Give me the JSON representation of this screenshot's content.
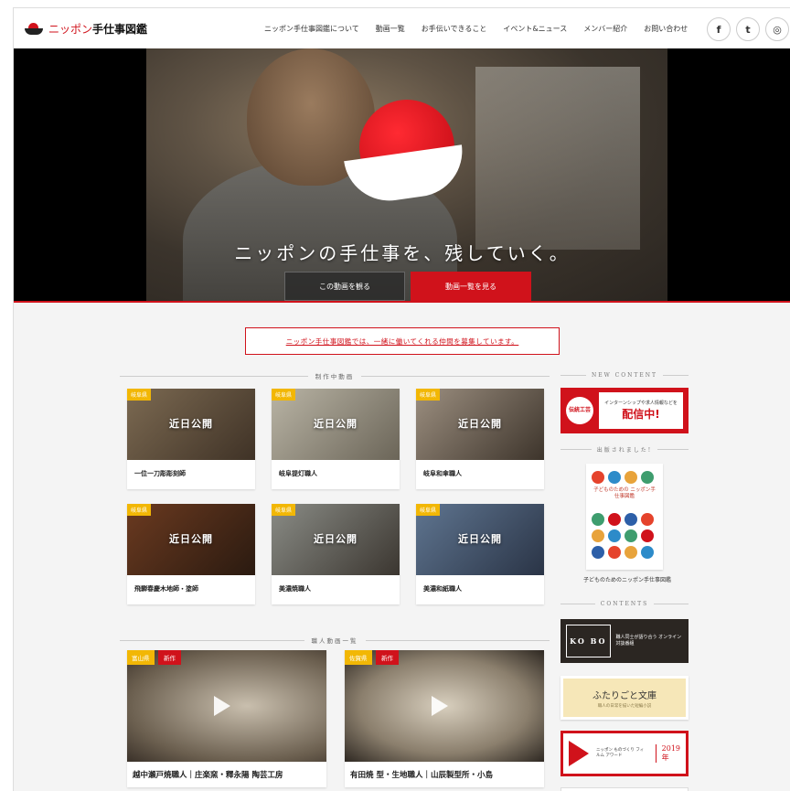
{
  "header": {
    "logo_red": "ニッポン",
    "logo_black": "手仕事図鑑",
    "nav": [
      "ニッポン手仕事図鑑について",
      "動画一覧",
      "お手伝いできること",
      "イベント&ニュース",
      "メンバー紹介",
      "お問い合わせ"
    ],
    "social": [
      {
        "icon": "facebook-icon",
        "glyph": "f"
      },
      {
        "icon": "twitter-icon",
        "glyph": "t"
      },
      {
        "icon": "instagram-icon",
        "glyph": "◎"
      }
    ]
  },
  "hero": {
    "tagline": "ニッポンの手仕事を、残していく。",
    "btn_watch": "この動画を観る",
    "btn_list": "動画一覧を見る"
  },
  "recruit": "ニッポン手仕事図鑑では、一緒に働いてくれる仲間を募集しています。",
  "production": {
    "heading": "制作中動画",
    "coming_soon": "近日公開",
    "cards": [
      {
        "pref": "岐阜県",
        "title": "一位一刀彫彫刻師"
      },
      {
        "pref": "岐阜県",
        "title": "岐阜提灯職人"
      },
      {
        "pref": "岐阜県",
        "title": "岐阜和傘職人"
      },
      {
        "pref": "岐阜県",
        "title": "飛騨春慶木地師・塗師"
      },
      {
        "pref": "岐阜県",
        "title": "美濃焼職人"
      },
      {
        "pref": "岐阜県",
        "title": "美濃和紙職人"
      }
    ]
  },
  "videos": {
    "heading": "職人動画一覧",
    "new_label": "新作",
    "items": [
      {
        "pref": "富山県",
        "title": "越中瀬戸焼職人｜庄楽窯・釋永陽 陶芸工房"
      },
      {
        "pref": "佐賀県",
        "title": "有田焼 型・生地職人｜山辰製型所・小島"
      }
    ]
  },
  "sidebar": {
    "new_content": "NEW CONTENT",
    "ad_logo": "伝統工芸",
    "ad_small": "インターンシップや求人情報などを",
    "ad_big": "配信中!",
    "published": "出版されました!",
    "book_title": "子どものための ニッポン手仕事図鑑",
    "book_caption": "子どものためのニッポン手仕事図鑑",
    "contents": "CONTENTS",
    "bar_mark": "KO BO",
    "bar_text": "職人同士が語り合う オンライン対談番組",
    "futari_title": "ふたりごと文庫",
    "futari_sub": "職人の日常を描いた短編小説",
    "award_small": "ニッポン ものづくり フィルム アワード",
    "award_year": "2019年"
  },
  "colors": {
    "brand_red": "#d0121b",
    "pref_yellow": "#f2b705"
  }
}
